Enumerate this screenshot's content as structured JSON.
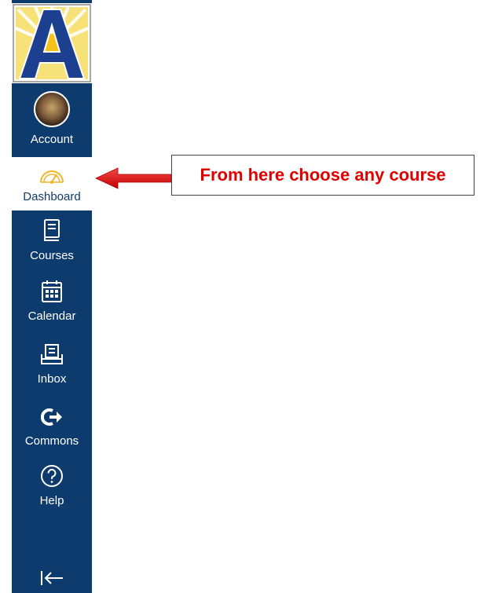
{
  "sidebar": {
    "logo_letter": "A",
    "items": [
      {
        "id": "account",
        "label": "Account",
        "icon": "avatar"
      },
      {
        "id": "dashboard",
        "label": "Dashboard",
        "icon": "dashboard-gauge-icon"
      },
      {
        "id": "courses",
        "label": "Courses",
        "icon": "courses-book-icon"
      },
      {
        "id": "calendar",
        "label": "Calendar",
        "icon": "calendar-icon"
      },
      {
        "id": "inbox",
        "label": "Inbox",
        "icon": "inbox-icon"
      },
      {
        "id": "commons",
        "label": "Commons",
        "icon": "commons-share-icon"
      },
      {
        "id": "help",
        "label": "Help",
        "icon": "help-question-icon"
      }
    ],
    "collapse_icon": "collapse-arrow-icon"
  },
  "annotation": {
    "text": "From here choose any course"
  },
  "colors": {
    "sidebar_bg": "#0d3b6e",
    "logo_navy": "#1d3f8f",
    "logo_yellow": "#f6d23a",
    "active_icon": "#f0b429",
    "annotation_red": "#e00000"
  }
}
